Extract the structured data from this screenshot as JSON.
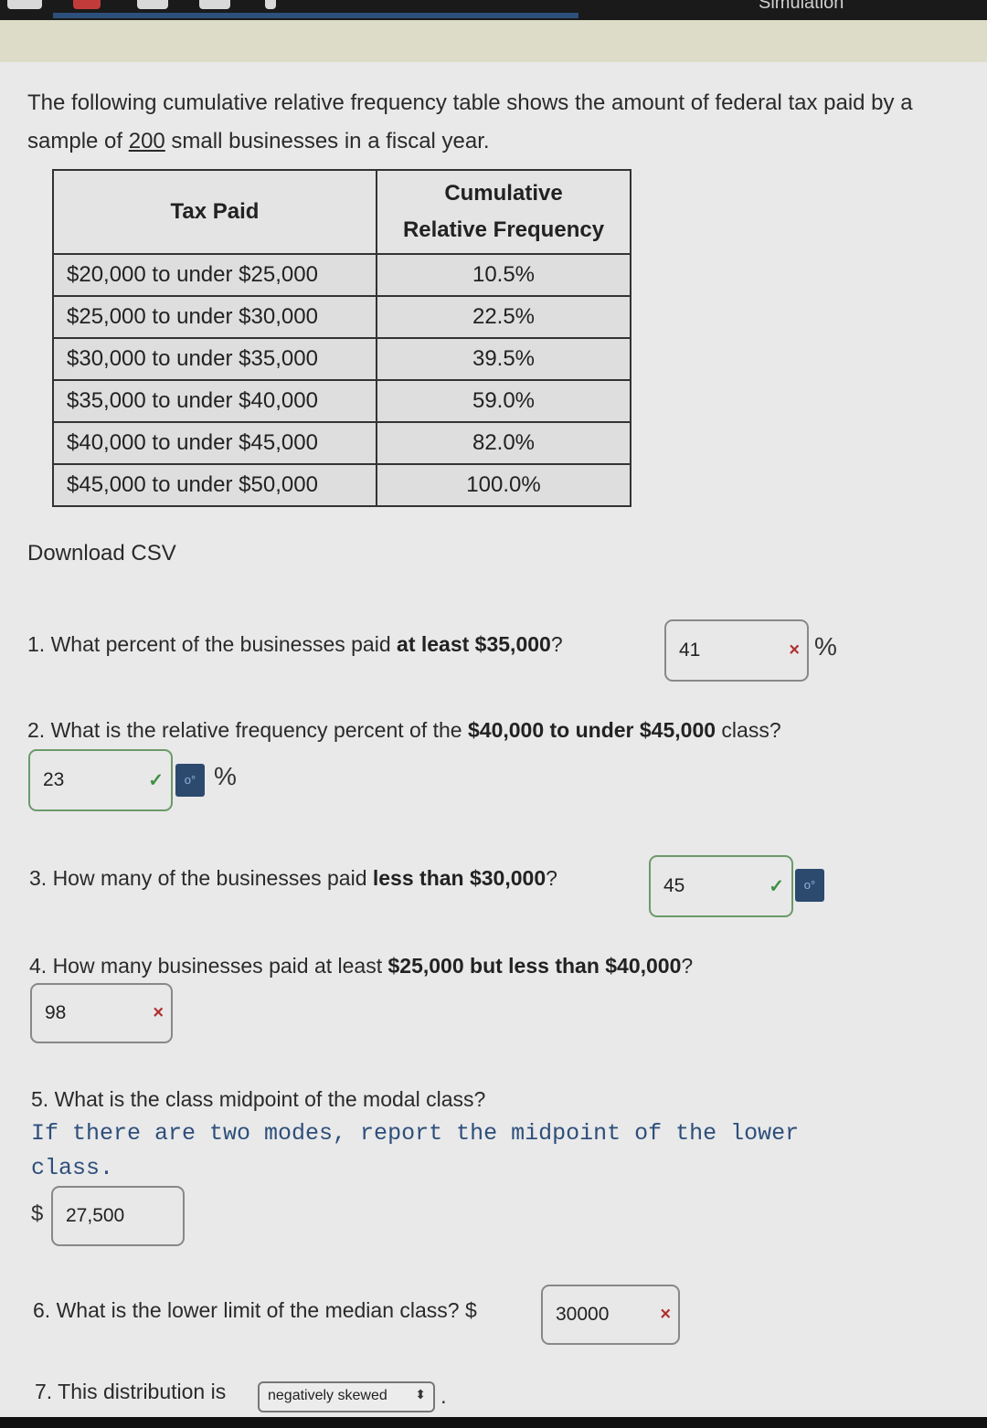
{
  "header": {
    "simulation_label": "Simulation"
  },
  "intro": {
    "text_before": "The following cumulative relative frequency table shows the amount of federal tax paid by a sample of ",
    "sample_size": "200",
    "text_after": " small businesses in a fiscal year."
  },
  "table": {
    "headers": {
      "col1": "Tax Paid",
      "col2_line1": "Cumulative",
      "col2_line2": "Relative Frequency"
    },
    "rows": [
      {
        "range": "$20,000 to under $25,000",
        "freq": "10.5%"
      },
      {
        "range": "$25,000 to under $30,000",
        "freq": "22.5%"
      },
      {
        "range": "$30,000 to under $35,000",
        "freq": "39.5%"
      },
      {
        "range": "$35,000 to under $40,000",
        "freq": "59.0%"
      },
      {
        "range": "$40,000 to under $45,000",
        "freq": "82.0%"
      },
      {
        "range": "$45,000 to under $50,000",
        "freq": "100.0%"
      }
    ]
  },
  "download_label": "Download CSV",
  "q1": {
    "prefix": "1. What percent of the businesses paid ",
    "bold": "at least $35,000",
    "suffix": "?",
    "answer": "41",
    "mark": "×",
    "unit": "%"
  },
  "q2": {
    "prefix": "2. What is the relative frequency percent of the ",
    "bold": "$40,000 to under $45,000",
    "suffix": " class?",
    "answer": "23",
    "mark": "✓",
    "unit": "%"
  },
  "q3": {
    "prefix": "3. How many of the businesses paid ",
    "bold": "less than $30,000",
    "suffix": "?",
    "answer": "45",
    "mark": "✓"
  },
  "q4": {
    "prefix": "4. How many businesses paid at least ",
    "bold": "$25,000 but less than $40,000",
    "suffix": "?",
    "answer": "98",
    "mark": "×"
  },
  "q5": {
    "text": "5. What is the class midpoint of the modal class?",
    "hint": "If there are two modes, report the midpoint of the lower class.",
    "currency": "$",
    "answer": "27,500"
  },
  "q6": {
    "text": "6. What is the lower limit of the median class? $",
    "answer": "30000",
    "mark": "×"
  },
  "q7": {
    "text": "7. This distribution is",
    "selected": "negatively skewed",
    "arrow": "⬍",
    "trailing": "."
  },
  "key_icon_label": "o°"
}
